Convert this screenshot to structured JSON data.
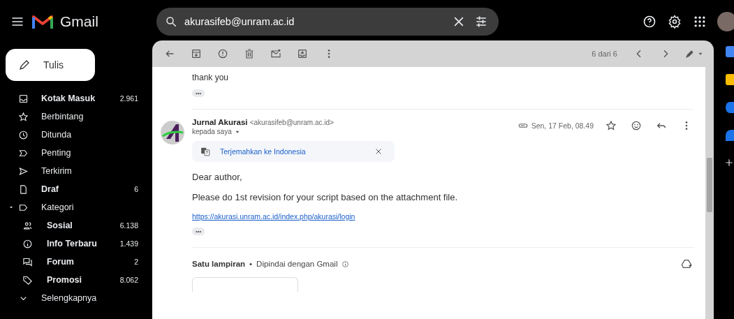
{
  "app": {
    "name": "Gmail"
  },
  "search": {
    "value": "akurasifeb@unram.ac.id"
  },
  "compose": {
    "label": "Tulis"
  },
  "sidebar": {
    "items": [
      {
        "label": "Kotak Masuk",
        "count": "2.961",
        "unread": true
      },
      {
        "label": "Berbintang",
        "unread": false
      },
      {
        "label": "Ditunda",
        "unread": false
      },
      {
        "label": "Penting",
        "unread": false
      },
      {
        "label": "Terkirim",
        "unread": false
      },
      {
        "label": "Draf",
        "count": "6",
        "unread": true
      },
      {
        "label": "Kategori",
        "unread": false,
        "expanded": true,
        "children": [
          {
            "label": "Sosial",
            "count": "6.138",
            "unread": true
          },
          {
            "label": "Info Terbaru",
            "count": "1.439",
            "unread": true
          },
          {
            "label": "Forum",
            "count": "2",
            "unread": true
          },
          {
            "label": "Promosi",
            "count": "8.062",
            "unread": true
          }
        ]
      },
      {
        "label": "Selengkapnya",
        "unread": false
      }
    ]
  },
  "toolbar": {
    "pager": "6 dari 6"
  },
  "thread": {
    "previous_message": {
      "body": "thank you",
      "more": "•••"
    },
    "message": {
      "sender_name": "Jurnal Akurasi",
      "sender_email": "<akurasifeb@unram.ac.id>",
      "recipient": "kepada saya",
      "date": "Sen, 17 Feb, 08.49",
      "translate": "Terjemahkan ke Indonesia",
      "body": [
        "Dear author,",
        "Please do 1st revision for your script based on the attachment file."
      ],
      "link": "https://akurasi.unram.ac.id/index.php/akurasi/login",
      "more": "•••",
      "attachments": {
        "title": "Satu lampiran",
        "separator": "•",
        "scan_note": "Dipindai dengan Gmail"
      }
    }
  }
}
